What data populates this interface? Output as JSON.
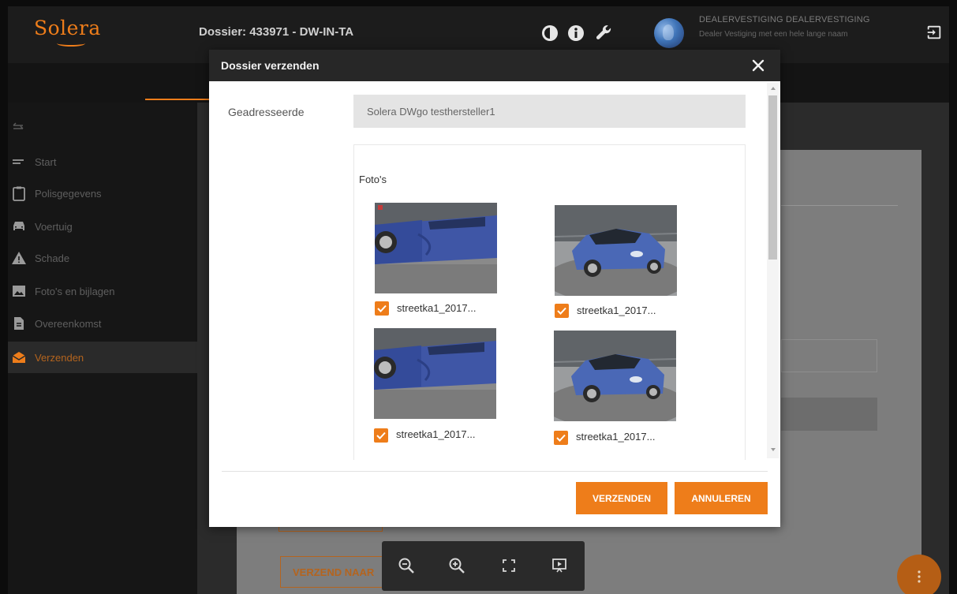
{
  "app": {
    "logo_text": "Solera",
    "dossier_title": "Dossier: 433971 - DW-IN-TA",
    "user_name": "DEALERVESTIGING DEALERVESTIGING",
    "user_branch": "Dealer Vestiging met een hele lange naam"
  },
  "header_icons": [
    "contrast-icon",
    "info-icon",
    "wrench-icon"
  ],
  "sidebar": {
    "items": [
      {
        "label": "Start",
        "icon": "menu-lines-icon",
        "active": false
      },
      {
        "label": "Polisgegevens",
        "icon": "clipboard-icon",
        "active": false
      },
      {
        "label": "Voertuig",
        "icon": "car-icon",
        "active": false
      },
      {
        "label": "Schade",
        "icon": "warning-icon",
        "active": false
      },
      {
        "label": "Foto's en bijlagen",
        "icon": "image-icon",
        "active": false
      },
      {
        "label": "Overeenkomst",
        "icon": "document-icon",
        "active": false
      },
      {
        "label": "Verzenden",
        "icon": "envelope-icon",
        "active": true
      }
    ]
  },
  "background": {
    "verzend_button_label": "VERZEND NAAR"
  },
  "modal": {
    "title": "Dossier verzenden",
    "addressee_label": "Geadresseerde",
    "addressee_value": "Solera DWgo testhersteller1",
    "photos_heading": "Foto's",
    "photos": [
      {
        "name": "streetka1_2017...",
        "checked": true,
        "view": "side"
      },
      {
        "name": "streetka1_2017...",
        "checked": true,
        "view": "front"
      },
      {
        "name": "streetka1_2017...",
        "checked": true,
        "view": "side"
      },
      {
        "name": "streetka1_2017...",
        "checked": true,
        "view": "front"
      }
    ],
    "send_label": "VERZENDEN",
    "cancel_label": "ANNULEREN"
  },
  "zoom_toolbar": [
    "zoom-out-icon",
    "zoom-in-icon",
    "fit-screen-icon",
    "present-icon"
  ],
  "colors": {
    "accent": "#ee7d1a",
    "header_bg": "#1c1c1c",
    "modal_header_bg": "#272727",
    "input_bg": "#e4e4e4"
  }
}
